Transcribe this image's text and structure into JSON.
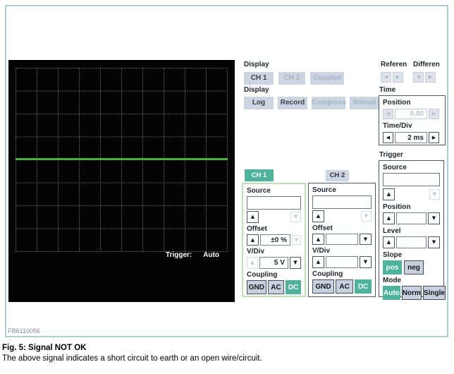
{
  "colors": {
    "teal": "#4db39c",
    "flat_button": "#ccd6e2",
    "signal": "#4bc937",
    "frame_border": "#accdd9"
  },
  "scope": {
    "grid_cols": 10,
    "grid_rows": 8,
    "signal_trace": "flat horizontal line at vertical center",
    "trigger_label": "Trigger:",
    "trigger_mode": "Auto"
  },
  "display_channels": {
    "label": "Display",
    "ch1": "CH 1",
    "ch2": "CH 2",
    "coupled": "Coupled"
  },
  "display_modes": {
    "label": "Display",
    "log": "Log",
    "record": "Record",
    "compress": "Compress",
    "stimuli": "Stimuli"
  },
  "reference": {
    "label": "Referen"
  },
  "difference": {
    "label": "Differen"
  },
  "time": {
    "label": "Time",
    "position_label": "Position",
    "position_value": "0.00",
    "timediv_label": "Time/Div",
    "timediv_value": "2 ms"
  },
  "trigger": {
    "label": "Trigger",
    "source_label": "Source",
    "source_value": "",
    "position_label": "Position",
    "position_value": "",
    "level_label": "Level",
    "level_value": "",
    "slope_label": "Slope",
    "slope_pos": "pos",
    "slope_neg": "neg",
    "mode_label": "Mode",
    "mode_auto": "Auto",
    "mode_norm": "Norm",
    "mode_single": "Single"
  },
  "ch1": {
    "tab": "CH 1",
    "source_label": "Source",
    "source_value": "",
    "offset_label": "Offset",
    "offset_value": "±0 %",
    "vdiv_label": "V/Div",
    "vdiv_value": "5 V",
    "coupling_label": "Coupling",
    "gnd": "GND",
    "ac": "AC",
    "dc": "DC"
  },
  "ch2": {
    "tab": "CH 2",
    "source_label": "Source",
    "source_value": "",
    "offset_label": "Offset",
    "offset_value": "",
    "vdiv_label": "V/Div",
    "vdiv_value": "",
    "coupling_label": "Coupling",
    "gnd": "GND",
    "ac": "AC",
    "dc": "DC"
  },
  "figure": {
    "fb_code": "FB6110056",
    "caption_title": "Fig. 5: Signal NOT OK",
    "caption_body": "The above signal indicates a short circuit to earth or an open wire/circuit."
  }
}
